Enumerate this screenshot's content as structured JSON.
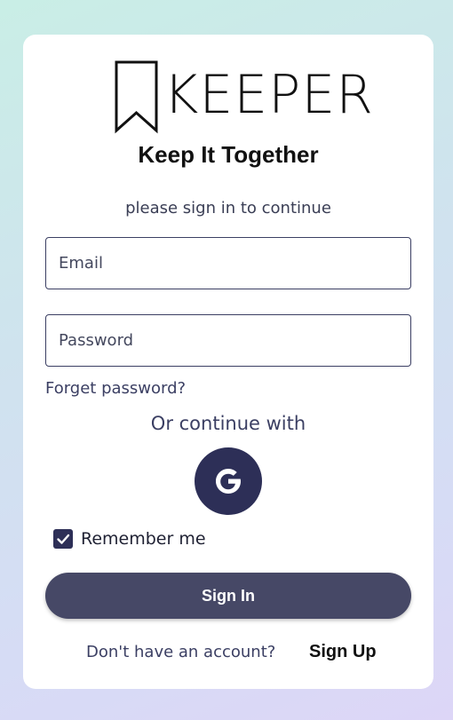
{
  "brand": {
    "name": "KEEPER",
    "tagline": "Keep It Together",
    "logo_icon": "bookmark-icon"
  },
  "login": {
    "subtitle": "please sign in to continue",
    "email_placeholder": "Email",
    "password_placeholder": "Password",
    "forgot_password": "Forget password?",
    "or_continue": "Or continue with",
    "google_icon": "google-icon",
    "remember_me": "Remember me",
    "remember_checked": true,
    "sign_in": "Sign In",
    "no_account": "Don't have an account?",
    "sign_up": "Sign Up"
  },
  "colors": {
    "primary": "#2d2f57",
    "button": "#464866",
    "text": "#3b3f63"
  }
}
